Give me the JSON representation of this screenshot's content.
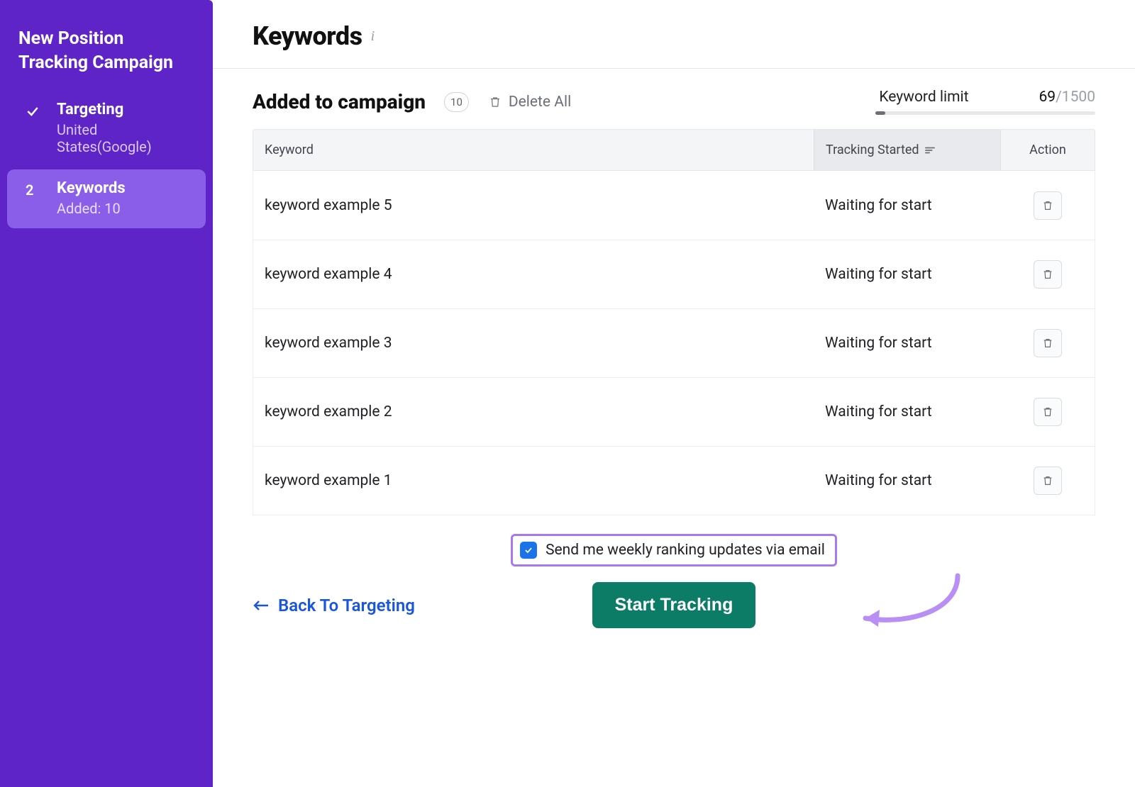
{
  "sidebar": {
    "title": "New Position Tracking Campaign",
    "steps": [
      {
        "marker": "check",
        "label": "Targeting",
        "sub": "United States(Google)",
        "active": false
      },
      {
        "marker": "2",
        "label": "Keywords",
        "sub": "Added: 10",
        "active": true
      }
    ]
  },
  "header": {
    "title": "Keywords"
  },
  "campaign": {
    "subheader": "Added to campaign",
    "count": "10",
    "delete_all": "Delete All",
    "limit_label": "Keyword limit",
    "limit_current": "69",
    "limit_sep": "/",
    "limit_max": "1500",
    "limit_pct": 4.6
  },
  "table": {
    "columns": {
      "keyword": "Keyword",
      "tracking": "Tracking Started",
      "action": "Action"
    },
    "rows": [
      {
        "kw": "keyword example 5",
        "status": "Waiting for start"
      },
      {
        "kw": "keyword example 4",
        "status": "Waiting for start"
      },
      {
        "kw": "keyword example 3",
        "status": "Waiting for start"
      },
      {
        "kw": "keyword example 2",
        "status": "Waiting for start"
      },
      {
        "kw": "keyword example 1",
        "status": "Waiting for start"
      }
    ]
  },
  "footer": {
    "weekly_label": "Send me weekly ranking updates via email",
    "weekly_checked": true,
    "back_label": "Back To Targeting",
    "start_label": "Start Tracking"
  }
}
